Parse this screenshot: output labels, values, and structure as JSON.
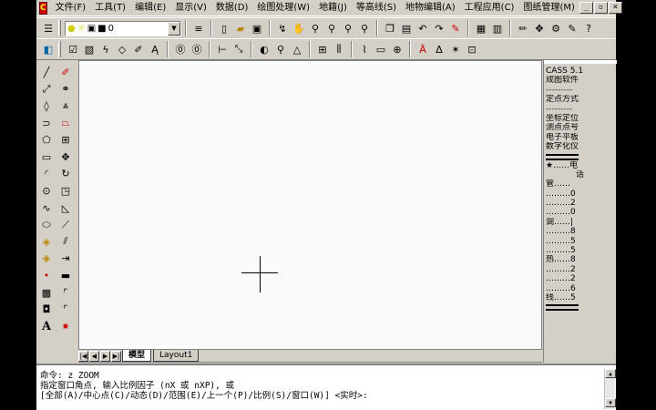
{
  "app": {
    "icon_label": "C"
  },
  "menus": [
    "文件(F)",
    "工具(T)",
    "编辑(E)",
    "显示(V)",
    "数据(D)",
    "绘图处理(W)",
    "地籍(J)",
    "等高线(S)",
    "地物编辑(A)",
    "工程应用(C)",
    "图纸管理(M)"
  ],
  "window_controls": {
    "minimize": "_",
    "restore": "▫",
    "close": "×"
  },
  "layer": {
    "current": "0"
  },
  "tabs": {
    "model": "模型",
    "layout1": "Layout1"
  },
  "right_panel": {
    "lines": [
      "CASS 5.1",
      "成图软件",
      "---------",
      "定点方式",
      "---------",
      "坐标定位",
      "测点点号",
      "电子平板",
      "数字化仪",
      "",
      "★……电",
      "话",
      "管……",
      "………0",
      "………2",
      "………0",
      "调……|",
      "………8",
      "………5",
      "………5",
      "热……8",
      "………2",
      "………2",
      "………6",
      "线……5"
    ]
  },
  "command": {
    "line1": "命令: z ZOOM",
    "line2": "指定窗口角点, 输入比例因子 (nX 或 nXP), 或",
    "line3": "[全部(A)/中心点(C)/动态(D)/范围(E)/上一个(P)/比例(S)/窗口(W)] <实时>:"
  }
}
